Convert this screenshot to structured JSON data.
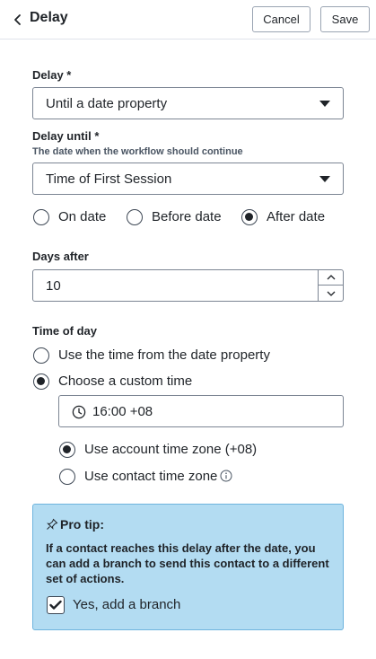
{
  "header": {
    "title": "Delay",
    "cancel_label": "Cancel",
    "save_label": "Save"
  },
  "delay": {
    "label": "Delay *",
    "selected": "Until a date property"
  },
  "delay_until": {
    "label": "Delay until *",
    "description": "The date when the workflow should continue",
    "selected": "Time of First Session"
  },
  "date_relation": {
    "options": [
      "On date",
      "Before date",
      "After date"
    ],
    "selected": "After date"
  },
  "days_after": {
    "label": "Days after",
    "value": "10"
  },
  "time_of_day": {
    "label": "Time of day",
    "options": [
      "Use the time from the date property",
      "Choose a custom time"
    ],
    "selected": "Choose a custom time",
    "custom_time": "16:00 +08",
    "timezone_options": [
      "Use account time zone (+08)",
      "Use contact time zone"
    ],
    "timezone_selected": "Use account time zone (+08)"
  },
  "pro_tip": {
    "title": "Pro tip:",
    "body": "If a contact reaches this delay after the date, you can add a branch to send this contact to a different set of actions.",
    "checkbox_label": "Yes, add a branch",
    "checked": true
  },
  "colors": {
    "tip_background": "#b3dcf2",
    "tip_border": "#6eb4de",
    "text": "#1f2328"
  }
}
